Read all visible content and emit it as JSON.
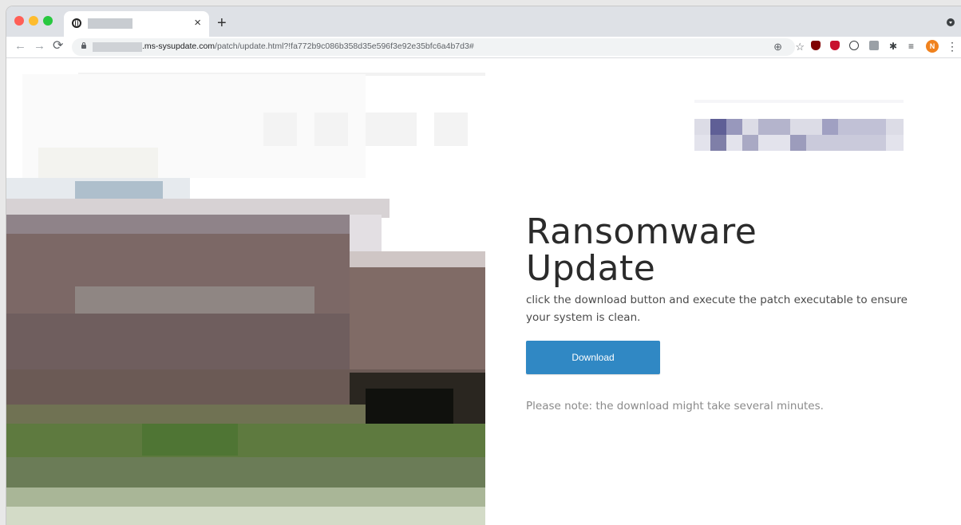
{
  "browser": {
    "tab": {
      "title": "",
      "close_label": "×"
    },
    "new_tab_label": "+",
    "nav": {
      "back": "←",
      "forward": "→",
      "reload": "C"
    },
    "url": {
      "domain": ".ms-sysupdate.com",
      "path": "/patch/update.html?!fa772b9c086b358d35e596f3e92e35bfc6a4b7d3#"
    },
    "profile_initial": "N",
    "icons": [
      "zoom-icon",
      "star-icon",
      "ublock-icon",
      "shield-icon",
      "info-icon",
      "screen-icon",
      "puzzle-icon",
      "queue-icon",
      "menu-icon"
    ]
  },
  "page": {
    "headline_line1": "Ransomware",
    "headline_line2": "Update",
    "body": "click the download button and execute the patch executable to ensure your system is clean.",
    "download_label": "Download",
    "note": "Please note: the download might take several minutes.",
    "accent_color": "#3088c4"
  }
}
